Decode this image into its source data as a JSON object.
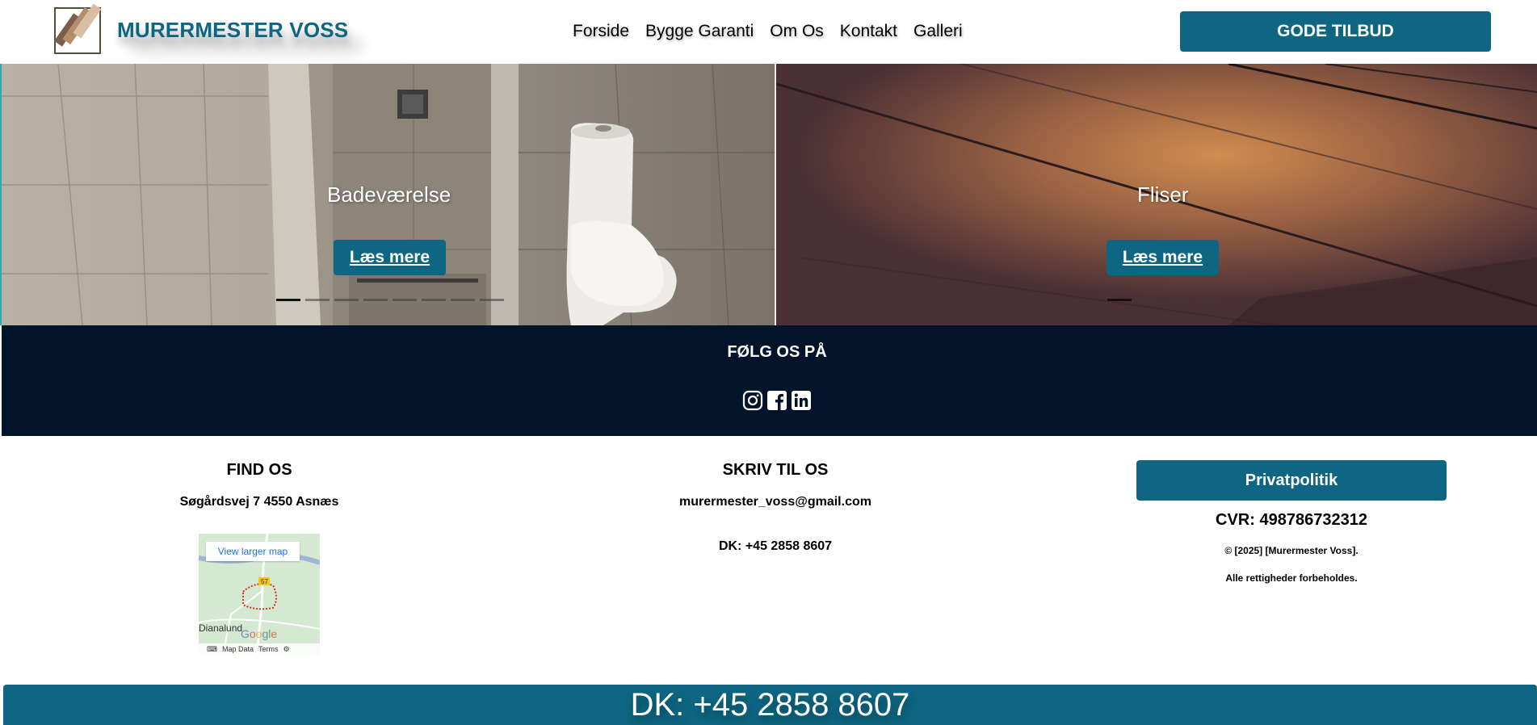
{
  "header": {
    "brand": "MURERMESTER VOSS",
    "nav": [
      "Forside",
      "Bygge Garanti",
      "Om Os",
      "Kontakt",
      "Galleri"
    ],
    "cta": "GODE TILBUD"
  },
  "slider": {
    "panels": [
      {
        "title": "Badeværelse",
        "button": "Læs mere",
        "dots_total": 8,
        "dots_active_index": 0
      },
      {
        "title": "Fliser",
        "button": "Læs mere",
        "dots_total": 4,
        "dots_active_index": 0
      }
    ]
  },
  "follow": {
    "title": "FØLG OS PÅ",
    "icons": [
      "instagram-icon",
      "facebook-icon",
      "linkedin-icon"
    ]
  },
  "footer": {
    "find": {
      "title": "FIND OS",
      "address": "Søgårdsvej 7 4550 Asnæs"
    },
    "map": {
      "button": "View larger map",
      "labels": [
        "Dianalund",
        "57"
      ],
      "footer": [
        "Map Data",
        "Terms"
      ]
    },
    "write": {
      "title": "SKRIV TIL OS",
      "email": "murermester_voss@gmail.com",
      "phone": "DK: +45 2858 8607"
    },
    "legal": {
      "privacy": "Privatpolitik",
      "cvr": "CVR: 498786732312",
      "copyright": "© [2025] [Murermester Voss].",
      "rights": "Alle rettigheder forbeholdes."
    }
  },
  "phone_bar": "DK: +45 2858 8607",
  "colors": {
    "brand": "#0e6682",
    "dark_band": "#01142a"
  }
}
